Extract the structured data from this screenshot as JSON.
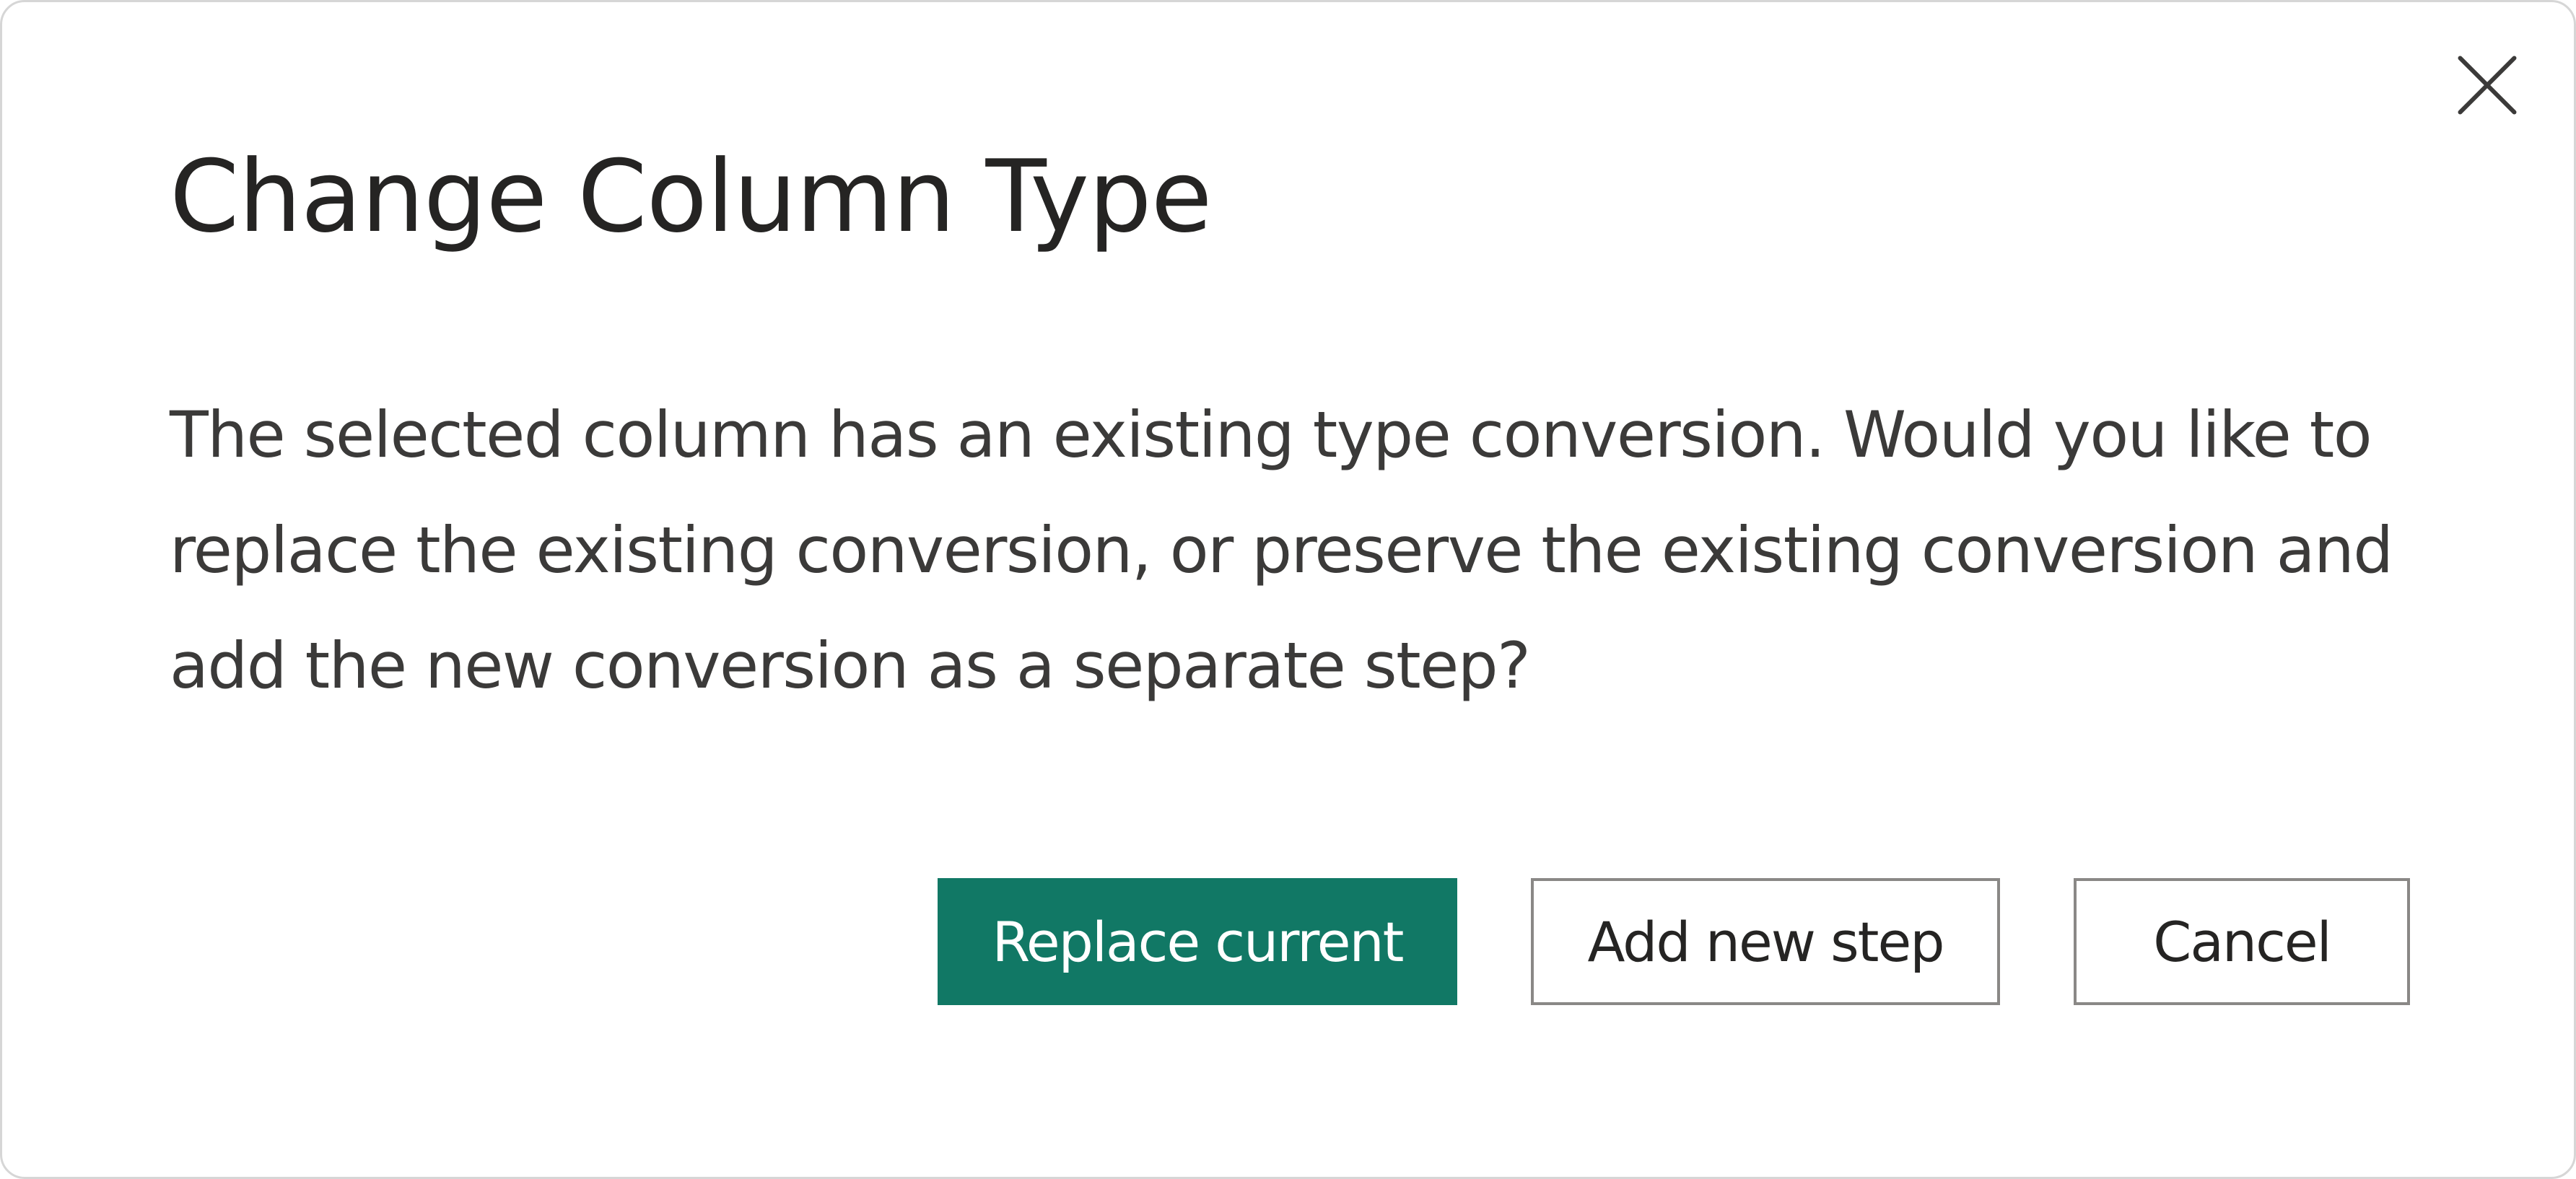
{
  "dialog": {
    "title": "Change Column Type",
    "message": "The selected column has an existing type conversion. Would you like to replace the existing conversion, or preserve the existing conversion and add the new conversion as a separate step?",
    "close_icon": "close-icon",
    "buttons": {
      "replace_label": "Replace current",
      "add_label": "Add new step",
      "cancel_label": "Cancel"
    }
  },
  "colors": {
    "primary": "#117865",
    "text": "#252423",
    "border": "#8a8886",
    "background": "#ffffff"
  }
}
